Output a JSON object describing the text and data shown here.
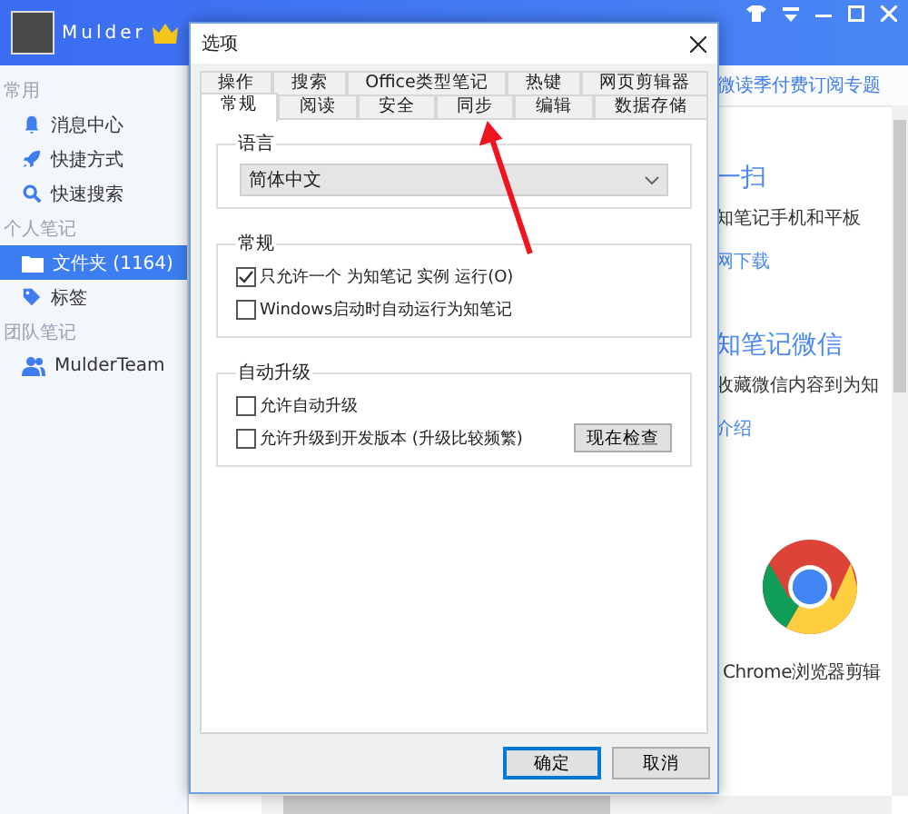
{
  "app": {
    "user": "Mulder",
    "sidebar": [
      {
        "title": "常用",
        "items": [
          {
            "label": "消息中心",
            "selected": false
          },
          {
            "label": "快捷方式",
            "selected": false
          },
          {
            "label": "快速搜索",
            "selected": false
          }
        ]
      },
      {
        "title": "个人笔记",
        "items": [
          {
            "label": "文件夹 (1164)",
            "selected": true
          },
          {
            "label": "标签",
            "selected": false
          }
        ]
      },
      {
        "title": "团队笔记",
        "items": [
          {
            "label": "MulderTeam",
            "selected": false
          }
        ]
      }
    ],
    "content": {
      "banner": "微读季付费订阅专题",
      "cards": [
        {
          "title": "一扫",
          "text": "知笔记手机和平板",
          "link": "网下载"
        },
        {
          "title": "知笔记微信",
          "text": "收藏微信内容到为知",
          "link": "介绍"
        }
      ],
      "extension": "Chrome浏览器剪辑"
    }
  },
  "dialog": {
    "title": "选项",
    "back_tabs": [
      {
        "label": "操作",
        "selected": false
      },
      {
        "label": "搜索",
        "selected": false
      },
      {
        "label": "Office类型笔记",
        "selected": false
      },
      {
        "label": "热键",
        "selected": false
      },
      {
        "label": "网页剪辑器",
        "selected": false
      }
    ],
    "front_tabs": [
      {
        "label": "常规",
        "selected": true
      },
      {
        "label": "阅读",
        "selected": false
      },
      {
        "label": "安全",
        "selected": false
      },
      {
        "label": "同步",
        "selected": false
      },
      {
        "label": "编辑",
        "selected": false
      },
      {
        "label": "数据存储",
        "selected": false
      }
    ],
    "language": {
      "title": "语言",
      "value": "简体中文"
    },
    "general": {
      "title": "常规",
      "options": [
        {
          "label": "只允许一个 为知笔记 实例 运行(O)",
          "checked": true
        },
        {
          "label": "Windows启动时自动运行为知笔记",
          "checked": false
        }
      ]
    },
    "upgrade": {
      "title": "自动升级",
      "options": [
        {
          "label": "允许自动升级",
          "checked": false
        },
        {
          "label": "允许升级到开发版本 (升级比较频繁)",
          "checked": false
        }
      ],
      "button": "现在检查"
    },
    "buttons": [
      {
        "label": "确定",
        "default": true
      },
      {
        "label": "取消",
        "default": false
      }
    ]
  }
}
